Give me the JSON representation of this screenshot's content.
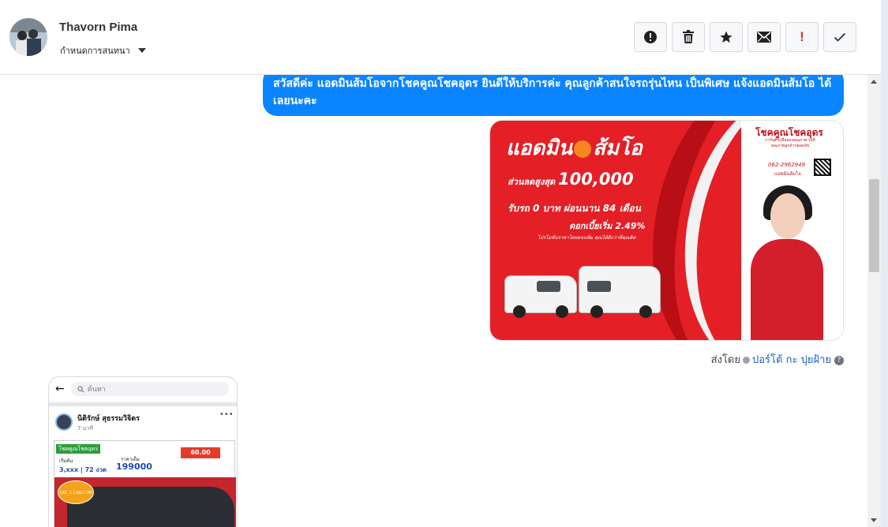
{
  "header": {
    "user_name": "Thavorn Pima",
    "assign_label": "กำหนดการสนทนา",
    "toolbar": [
      {
        "name": "report-spam",
        "icon": "alert-circle-icon"
      },
      {
        "name": "delete",
        "icon": "trash-icon"
      },
      {
        "name": "star",
        "icon": "star-icon"
      },
      {
        "name": "mark-unread",
        "icon": "envelope-icon"
      },
      {
        "name": "important",
        "icon": "exclamation-icon",
        "label": "!"
      },
      {
        "name": "done",
        "icon": "checkmark-icon"
      }
    ]
  },
  "messages": {
    "outgoing_text": "สวัสดีค่ะ แอดมินส้มโอจากโชคคูณโชคอุดร ยินดีให้บริการค่ะ คุณลูกค้าสนใจรถรุ่นไหน เป็นพิเศษ แจ้งแอดมินส้มโอ ได้เลยนะคะ",
    "promo_image": {
      "title_left": "แอดมิน",
      "title_right": "ส้มโอ",
      "line1": "ส่วนลดสูงสุด",
      "amount": "100,000",
      "line2": "รับรถ 0 บาท ผ่อนนาน 84 เดือน",
      "line3": "ดอกเบี้ยเริ่ม 2.49%",
      "line4": "โปรโมชั่นราคาโดยตรงเพิ่ม คุณได้ดีกว่าที่คุณคิด",
      "brand": "โชคคูณโชคอุดร",
      "brand_sub": "การันตีรถมือสองคุณภาพ รถดี คุณภาพลูกค้าปลอดภัย",
      "phone": "062-2962949",
      "phone_sub": "แอดมินส้มโอ"
    },
    "sent_by_label": "ส่งโดย",
    "sent_by_agent": "ปอร์โต้ กะ ปุยฝ้าย",
    "help_icon": "?"
  },
  "incoming_screenshot": {
    "search_placeholder": "ค้นหา",
    "poster_name": "นิติรักษ์ สุธรรมวิจิตร",
    "post_time": "7 นาที",
    "ad_brand": "โชคคูณโชคอุดร",
    "ad_badge": "60.00",
    "ad_down": "เริ่มต้น",
    "ad_installment": "3,xxx | 72 งวด",
    "ad_price_label": "ราคาเต็ม",
    "ad_price": "199000",
    "ad_logo": "CKC_1 CAR.COM"
  }
}
